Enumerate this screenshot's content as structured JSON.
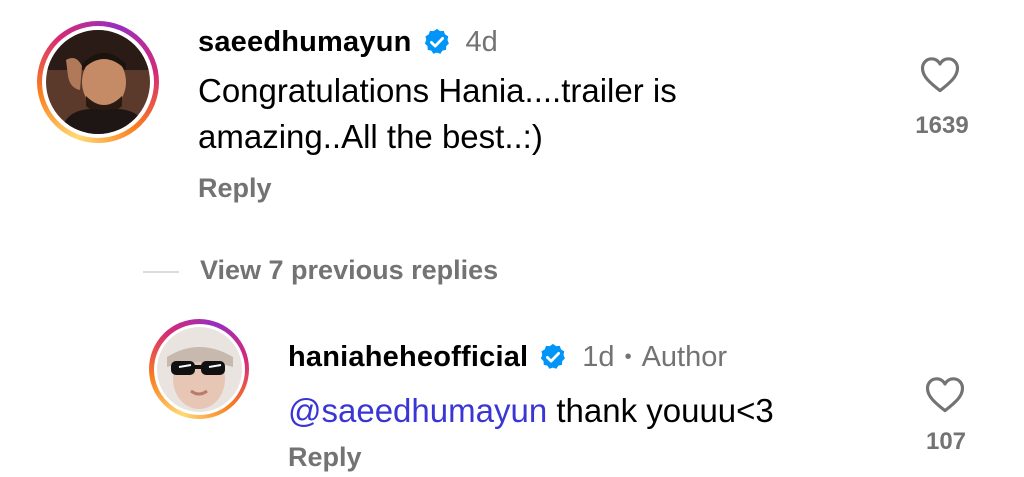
{
  "comment": {
    "username": "saeedhumayun",
    "time": "4d",
    "text_line1": "Congratulations Hania....trailer is",
    "text_line2": "amazing..All the best..:)",
    "reply_label": "Reply",
    "like_count": "1639"
  },
  "view_replies": {
    "label": "View 7 previous replies"
  },
  "reply_comment": {
    "username": "haniaheheofficial",
    "time": "1d",
    "separator": "•",
    "author_badge": "Author",
    "mention": "@saeedhumayun",
    "text": " thank youuu<3",
    "reply_label": "Reply",
    "like_count": "107"
  },
  "colors": {
    "verified": "#0095f6",
    "muted": "#737373",
    "mention": "#3a36d4"
  },
  "icons": {
    "like": "heart-outline-icon",
    "verified": "verified-badge-icon"
  }
}
